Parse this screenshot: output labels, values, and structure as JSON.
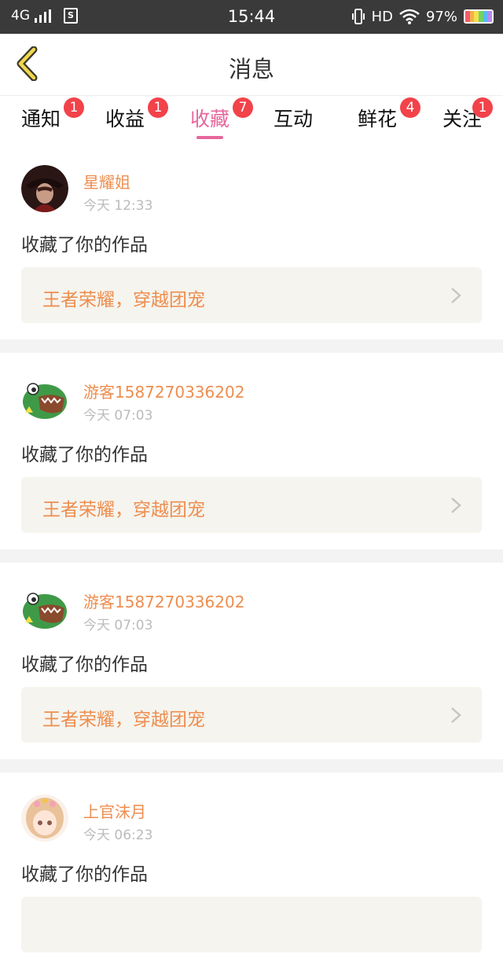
{
  "status_bar": {
    "network": "4G",
    "sim_label": "S",
    "time": "15:44",
    "hd": "HD",
    "battery": "97%"
  },
  "header": {
    "title": "消息",
    "back_icon": "chevron-left-icon",
    "accent": "#e8c84a"
  },
  "tabs": [
    {
      "label": "通知",
      "badge": "1"
    },
    {
      "label": "收益",
      "badge": "1"
    },
    {
      "label": "收藏",
      "badge": "7",
      "active": true
    },
    {
      "label": "互动",
      "badge": ""
    },
    {
      "label": "鲜花",
      "badge": "4"
    },
    {
      "label": "关注",
      "badge": "1"
    }
  ],
  "items": [
    {
      "name": "星耀姐",
      "time": "今天 12:33",
      "action": "收藏了你的作品",
      "work": "王者荣耀，穿越团宠",
      "avatar": "dark-character-avatar"
    },
    {
      "name": "游客1587270336202",
      "time": "今天 07:03",
      "action": "收藏了你的作品",
      "work": "王者荣耀，穿越团宠",
      "avatar": "green-dino-avatar"
    },
    {
      "name": "游客1587270336202",
      "time": "今天 07:03",
      "action": "收藏了你的作品",
      "work": "王者荣耀，穿越团宠",
      "avatar": "green-dino-avatar"
    },
    {
      "name": "上官沫月",
      "time": "今天 06:23",
      "action": "收藏了你的作品",
      "work": "",
      "avatar": "anime-girl-avatar"
    }
  ],
  "colors": {
    "accent_pink": "#e6679c",
    "badge_red": "#f2424a",
    "name_orange": "#ee8d4e",
    "card_bg": "#f5f4ee"
  }
}
